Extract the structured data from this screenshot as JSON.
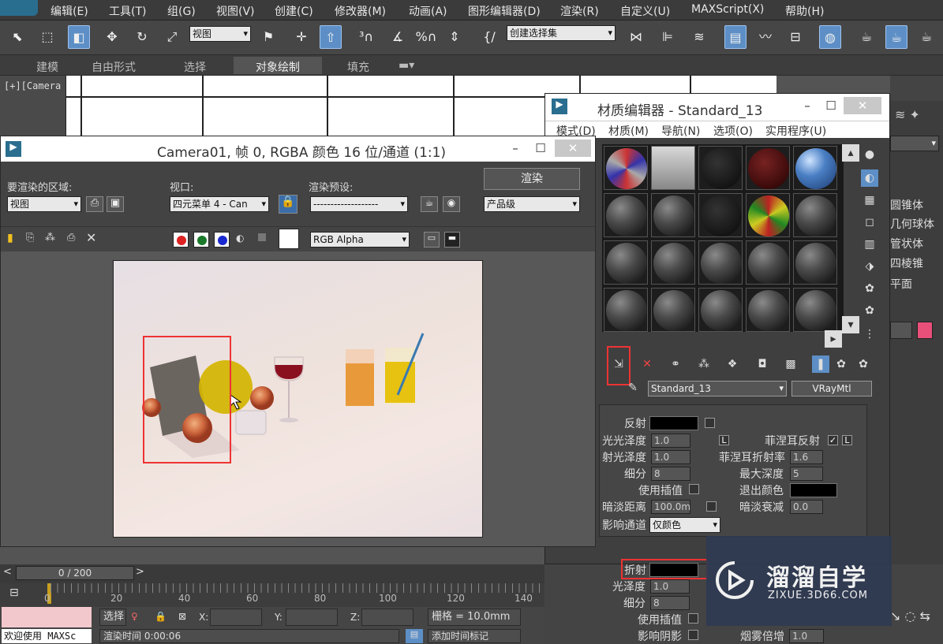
{
  "menubar": {
    "items": [
      "编辑(E)",
      "工具(T)",
      "组(G)",
      "视图(V)",
      "创建(C)",
      "修改器(M)",
      "动画(A)",
      "图形编辑器(D)",
      "渲染(R)",
      "自定义(U)",
      "MAXScript(X)",
      "帮助(H)"
    ]
  },
  "toolbar": {
    "view_dropdown": "视图",
    "selection_set": "创建选择集"
  },
  "ribbon": {
    "tabs": [
      "建模",
      "自由形式",
      "选择",
      "对象绘制",
      "填充"
    ]
  },
  "viewport": {
    "label": "[+][Camera"
  },
  "render_window": {
    "title": "Camera01, 帧 0, RGBA 颜色 16 位/通道 (1:1)",
    "area_label": "要渲染的区域:",
    "area_value": "视图",
    "viewport_label": "视口:",
    "viewport_value": "四元菜单 4 - Can",
    "preset_label": "渲染预设:",
    "preset_value": "-------------------",
    "render_button": "渲染",
    "quality_value": "产品级",
    "channel_value": "RGB Alpha"
  },
  "material_editor": {
    "title": "材质编辑器 - Standard_13",
    "menu": [
      "模式(D)",
      "材质(M)",
      "导航(N)",
      "选项(O)",
      "实用程序(U)"
    ],
    "material_name": "Standard_13",
    "material_type": "VRayMtl",
    "params": {
      "reflect": "反射",
      "gloss": "光光泽度",
      "gloss_val": "1.0",
      "refl_gloss": "射光泽度",
      "refl_gloss_val": "1.0",
      "subdiv": "细分",
      "subdiv_val": "8",
      "use_interp": "使用插值",
      "dim_dist": "暗淡距离",
      "dim_dist_val": "100.0m",
      "affect_ch": "影响通道",
      "affect_ch_val": "仅颜色",
      "fresnel": "菲涅耳反射",
      "fresnel_l": "L",
      "fresnel_ior": "菲涅耳折射率",
      "fresnel_ior_val": "1.6",
      "max_depth": "最大深度",
      "max_depth_val": "5",
      "exit_color": "退出颜色",
      "dim_falloff": "暗淡衰减",
      "dim_falloff_val": "0.0",
      "refract": "折射",
      "r_gloss": "光泽度",
      "r_gloss_val": "1.0",
      "r_subdiv": "细分",
      "r_subdiv_val": "8",
      "r_use_interp": "使用插值",
      "affect_shadow": "影响阴影",
      "fog_mult": "烟雾倍增",
      "fog_mult_val": "1.0"
    }
  },
  "command_panel": {
    "items": [
      "圆锥体",
      "几何球体",
      "管状体",
      "四棱锥",
      "平面"
    ]
  },
  "timeline": {
    "frame": "0 / 200",
    "ticks": [
      "0",
      "20",
      "40",
      "60",
      "80",
      "100",
      "120",
      "140"
    ]
  },
  "status": {
    "welcome": "欢迎使用 MAXSc",
    "select": "选择",
    "x": "X:",
    "y": "Y:",
    "z": "Z:",
    "grid": "栅格 = 10.0mm",
    "render_time": "渲染时间 0:00:06",
    "add_tag": "添加时间标记"
  },
  "watermark": {
    "brand": "溜溜自学",
    "url": "ZIXUE.3D66.COM"
  },
  "colors": {
    "accent": "#5d8fc6",
    "highlight": "#e33333",
    "swatch_pink": "#e8507a"
  }
}
